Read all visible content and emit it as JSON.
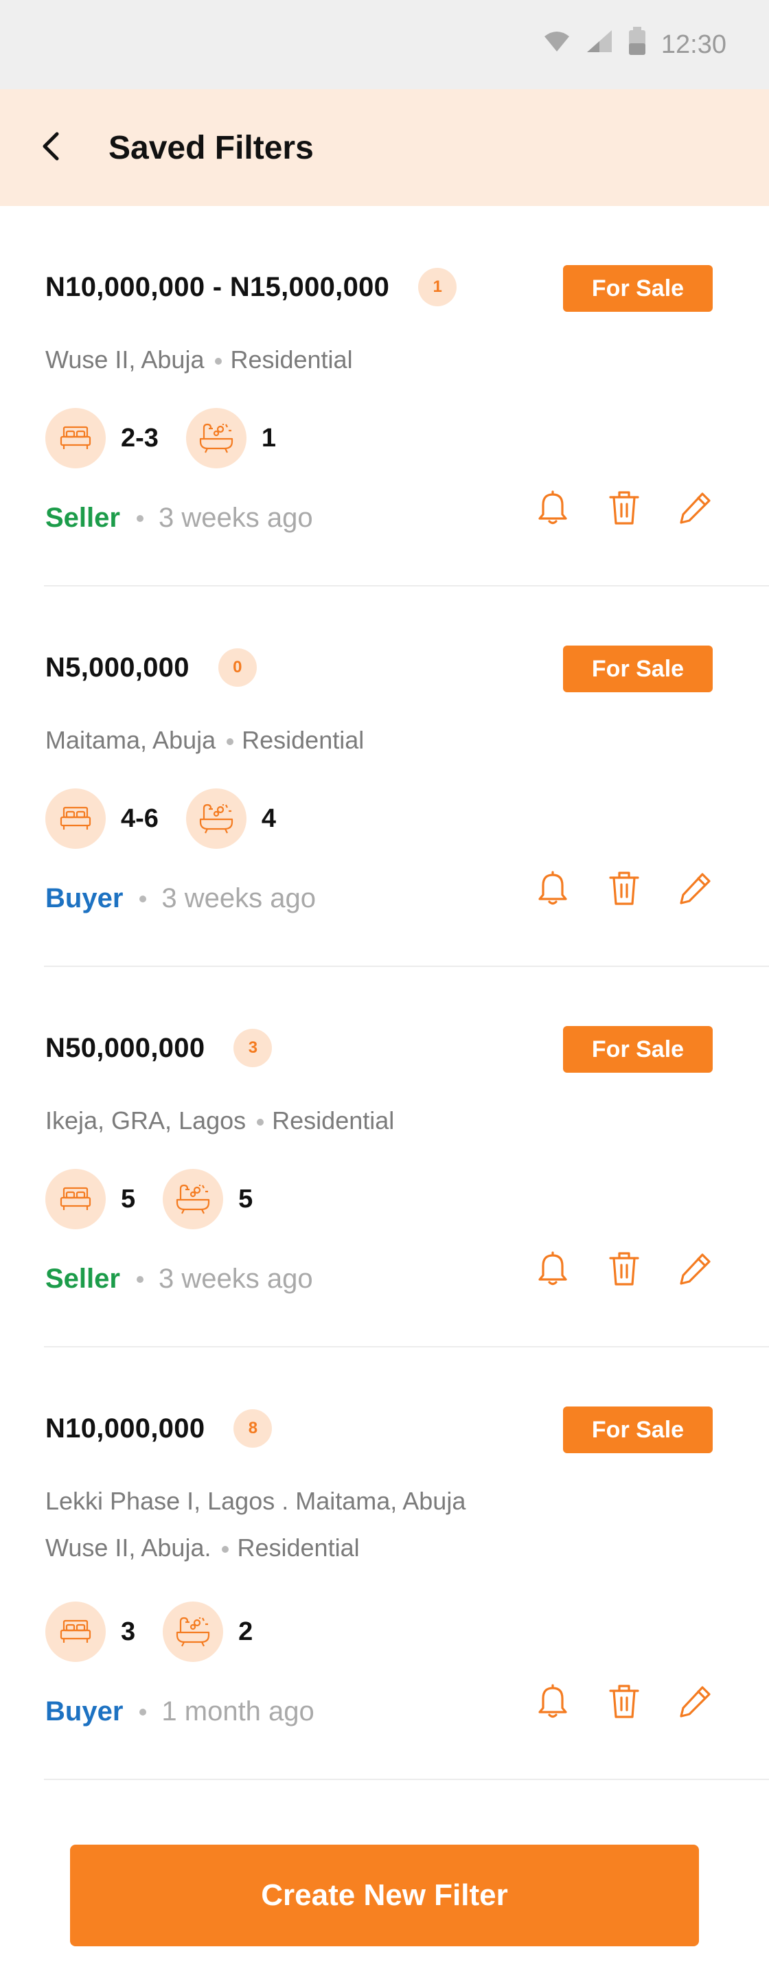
{
  "status_bar": {
    "time": "12:30",
    "icons": [
      "wifi-icon",
      "signal-icon",
      "battery-icon"
    ]
  },
  "header": {
    "title": "Saved Filters",
    "back_icon": "chevron-left-icon"
  },
  "colors": {
    "accent": "#f78121",
    "accent_light": "#fde3cf",
    "seller": "#1c9c4a",
    "buyer": "#1d72c2",
    "header_bg": "#fdebdd"
  },
  "filters": [
    {
      "price": "N10,000,000 - N15,000,000",
      "count": "1",
      "tag": "For Sale",
      "location": "Wuse II, Abuja",
      "location2": "",
      "type": "Residential",
      "bedrooms": "2-3",
      "bathrooms": "1",
      "role": "Seller",
      "time": "3 weeks ago"
    },
    {
      "price": "N5,000,000",
      "count": "0",
      "tag": "For Sale",
      "location": "Maitama, Abuja",
      "location2": "",
      "type": "Residential",
      "bedrooms": "4-6",
      "bathrooms": "4",
      "role": "Buyer",
      "time": "3 weeks ago"
    },
    {
      "price": "N50,000,000",
      "count": "3",
      "tag": "For Sale",
      "location": "Ikeja, GRA, Lagos",
      "location2": "",
      "type": "Residential",
      "bedrooms": "5",
      "bathrooms": "5",
      "role": "Seller",
      "time": "3 weeks ago"
    },
    {
      "price": "N10,000,000",
      "count": "8",
      "tag": "For Sale",
      "location": "Lekki Phase I, Lagos . Maitama, Abuja",
      "location2": "Wuse II, Abuja.",
      "type": "Residential",
      "bedrooms": "3",
      "bathrooms": "2",
      "role": "Buyer",
      "time": "1 month ago"
    }
  ],
  "actions": {
    "icons": [
      "bell-icon",
      "trash-icon",
      "pencil-icon"
    ]
  },
  "cta": {
    "label": "Create New Filter"
  }
}
